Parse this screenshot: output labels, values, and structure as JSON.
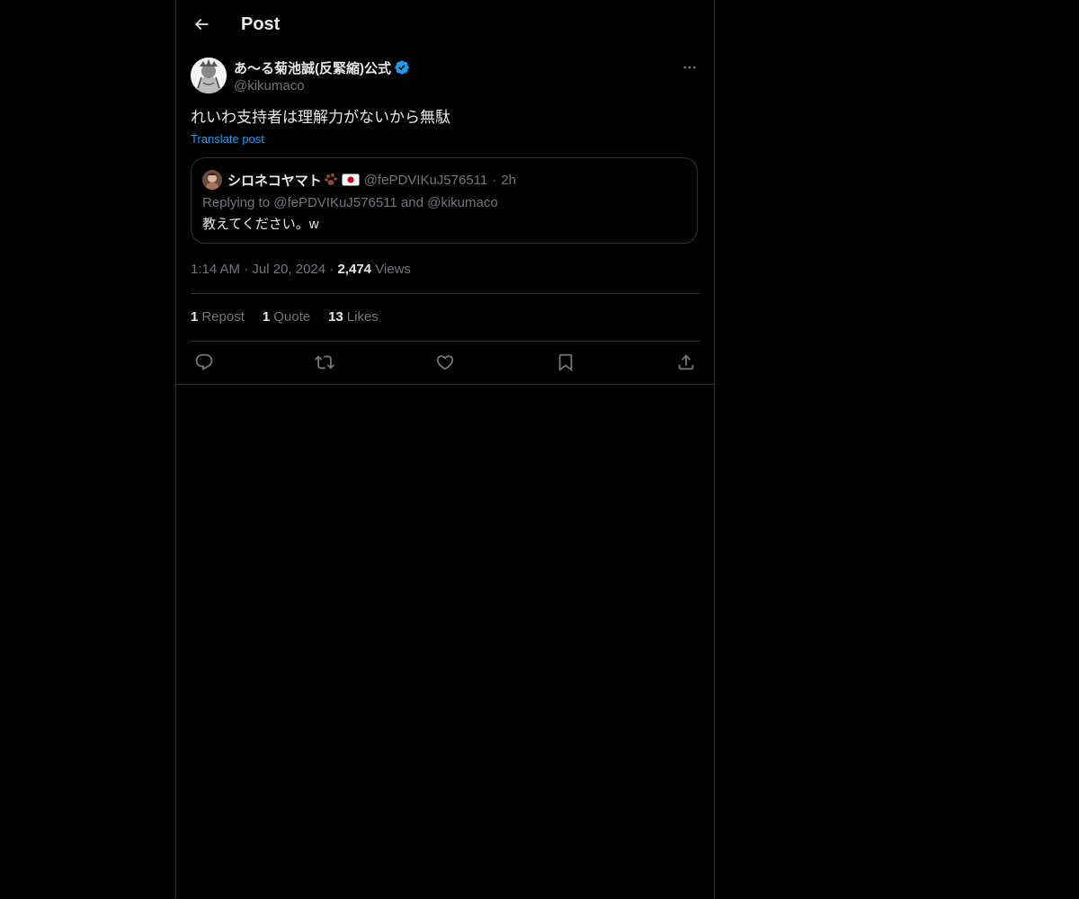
{
  "header": {
    "title": "Post"
  },
  "post": {
    "author_name": "あ〜る菊池誠(反緊縮)公式",
    "author_handle": "@kikumaco",
    "text": "れいわ支持者は理解力がないから無駄",
    "translate_label": "Translate post",
    "time": "1:14 AM",
    "date": "Jul 20, 2024",
    "views_count": "2,474",
    "views_label": "Views"
  },
  "quote": {
    "name": "シロネコヤマト",
    "handle": "@fePDVIKuJ576511",
    "time": "2h",
    "reply_line": "Replying to @fePDVIKuJ576511 and @kikumaco",
    "text": "教えてください。w"
  },
  "stats": {
    "reposts_count": "1",
    "reposts_label": "Repost",
    "quotes_count": "1",
    "quotes_label": "Quote",
    "likes_count": "13",
    "likes_label": "Likes"
  },
  "colors": {
    "background": "#000000",
    "border": "#2f3336",
    "text_primary": "#e7e9ea",
    "text_secondary": "#71767b",
    "accent": "#1d9bf0"
  },
  "icons": {
    "back": "arrow-left-icon",
    "verified": "verified-badge-icon",
    "more": "more-horizontal-icon",
    "reply": "reply-icon",
    "repost": "repost-icon",
    "like": "heart-icon",
    "bookmark": "bookmark-icon",
    "share": "share-icon"
  }
}
